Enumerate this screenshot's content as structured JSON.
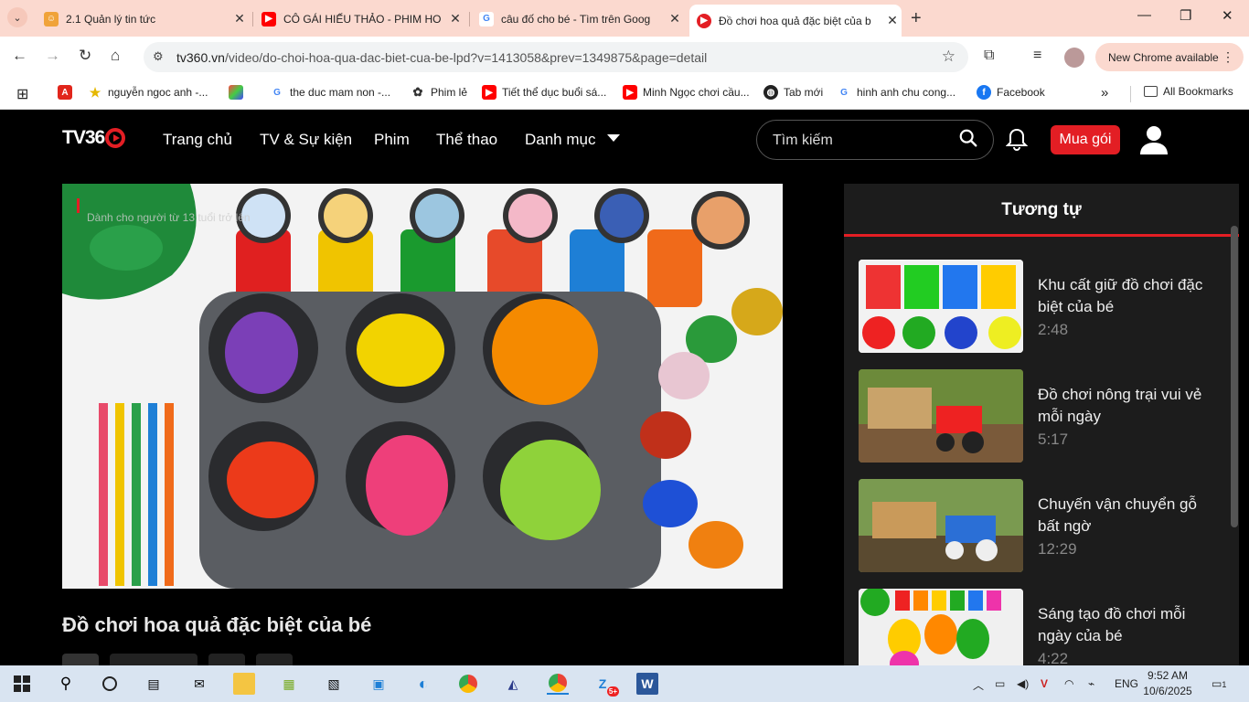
{
  "tabs": [
    {
      "title": "2.1 Quản lý tin tức",
      "icon": "smiley-icon"
    },
    {
      "title": "CÔ GÁI HIẾU THẢO - PHIM HO",
      "icon": "youtube-icon"
    },
    {
      "title": "câu đố cho bé - Tìm trên Goog",
      "icon": "google-icon"
    },
    {
      "title": "Đồ chơi hoa quả đặc biệt của b",
      "icon": "tv360-icon"
    }
  ],
  "omnibox": {
    "url_host": "tv360.vn",
    "url_path": "/video/do-choi-hoa-qua-dac-biet-cua-be-lpd?v=1413058&prev=1349875&page=detail"
  },
  "chrome_update": "New Chrome available",
  "bookmarks": [
    {
      "label": "",
      "icon": "adobe-icon"
    },
    {
      "label": "nguyễn ngoc anh -...",
      "icon": "star-icon"
    },
    {
      "label": "",
      "icon": "colorful-icon"
    },
    {
      "label": "the duc mam non -...",
      "icon": "google-icon"
    },
    {
      "label": "Phim lẻ",
      "icon": "film-icon"
    },
    {
      "label": "Tiết thể dục buổi sá...",
      "icon": "youtube-icon"
    },
    {
      "label": "Minh Ngọc chơi cầu...",
      "icon": "youtube-icon"
    },
    {
      "label": "Tab mới",
      "icon": "globe-icon"
    },
    {
      "label": "hinh anh chu cong...",
      "icon": "google-icon"
    },
    {
      "label": "Facebook",
      "icon": "facebook-icon"
    }
  ],
  "all_bookmarks": "All Bookmarks",
  "site": {
    "logo": "TV36",
    "menu": [
      "Trang chủ",
      "TV & Sự kiện",
      "Phim",
      "Thể thao",
      "Danh mục"
    ],
    "search_placeholder": "Tìm kiếm",
    "buy_label": "Mua gói",
    "age_notice": "Dành cho người từ 13 tuổi trở lên",
    "video_title": "Đồ chơi hoa quả đặc biệt của bé",
    "sidebar_title": "Tương tự",
    "related": [
      {
        "title": "Khu cất giữ đồ chơi đặc biệt của bé",
        "duration": "2:48"
      },
      {
        "title": "Đồ chơi nông trại vui vẻ mỗi ngày",
        "duration": "5:17"
      },
      {
        "title": "Chuyến vận chuyển gỗ bất ngờ",
        "duration": "12:29"
      },
      {
        "title": "Sáng tạo đồ chơi mỗi ngày của bé",
        "duration": "4:22"
      }
    ]
  },
  "taskbar": {
    "lang": "ENG",
    "time": "9:52 AM",
    "date": "10/6/2025",
    "notif_count": "1",
    "zalo_badge": "5+"
  }
}
